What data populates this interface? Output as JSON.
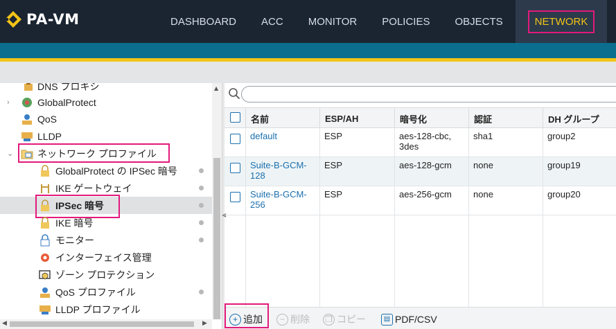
{
  "app": {
    "title": "PA-VM"
  },
  "nav": {
    "items": [
      "DASHBOARD",
      "ACC",
      "MONITOR",
      "POLICIES",
      "OBJECTS",
      "NETWORK"
    ],
    "active": "NETWORK"
  },
  "tree": {
    "items": [
      {
        "label": "DNS プロキシ",
        "icon": "dns-proxy-icon"
      },
      {
        "label": "GlobalProtect",
        "icon": "globalprotect-icon"
      },
      {
        "label": "QoS",
        "icon": "qos-icon"
      },
      {
        "label": "LLDP",
        "icon": "lldp-icon"
      },
      {
        "label": "ネットワーク プロファイル",
        "icon": "folder-icon"
      },
      {
        "label": "GlobalProtect の IPSec 暗号",
        "icon": "lock-icon"
      },
      {
        "label": "IKE ゲートウェイ",
        "icon": "gateway-icon"
      },
      {
        "label": "IPSec 暗号",
        "icon": "lock-icon"
      },
      {
        "label": "IKE 暗号",
        "icon": "lock-icon"
      },
      {
        "label": "モニター",
        "icon": "monitor-icon"
      },
      {
        "label": "インターフェイス管理",
        "icon": "interface-mgmt-icon"
      },
      {
        "label": "ゾーン プロテクション",
        "icon": "zone-protection-icon"
      },
      {
        "label": "QoS プロファイル",
        "icon": "qos-icon"
      },
      {
        "label": "LLDP プロファイル",
        "icon": "lldp-icon"
      }
    ],
    "selected": "IPSec 暗号"
  },
  "search": {
    "placeholder": "",
    "value": ""
  },
  "table": {
    "columns": [
      "名前",
      "ESP/AH",
      "暗号化",
      "認証",
      "DH グループ"
    ],
    "rows": [
      {
        "name": "default",
        "esp_ah": "ESP",
        "enc1": "aes-128-cbc,",
        "enc2": "3des",
        "auth": "sha1",
        "dh": "group2"
      },
      {
        "name1": "Suite-B-GCM-",
        "name2": "128",
        "esp_ah": "ESP",
        "enc1": "aes-128-gcm",
        "auth": "none",
        "dh": "group19"
      },
      {
        "name1": "Suite-B-GCM-",
        "name2": "256",
        "esp_ah": "ESP",
        "enc1": "aes-256-gcm",
        "auth": "none",
        "dh": "group20"
      }
    ]
  },
  "toolbar": {
    "add": "追加",
    "delete": "削除",
    "copy": "コピー",
    "pdf": "PDF/CSV"
  },
  "colors": {
    "nav_bg": "#1b2532",
    "accent_gold": "#f2c417",
    "teal": "#0b6e8f",
    "highlight": "#e2197b",
    "link": "#1a6fae"
  }
}
